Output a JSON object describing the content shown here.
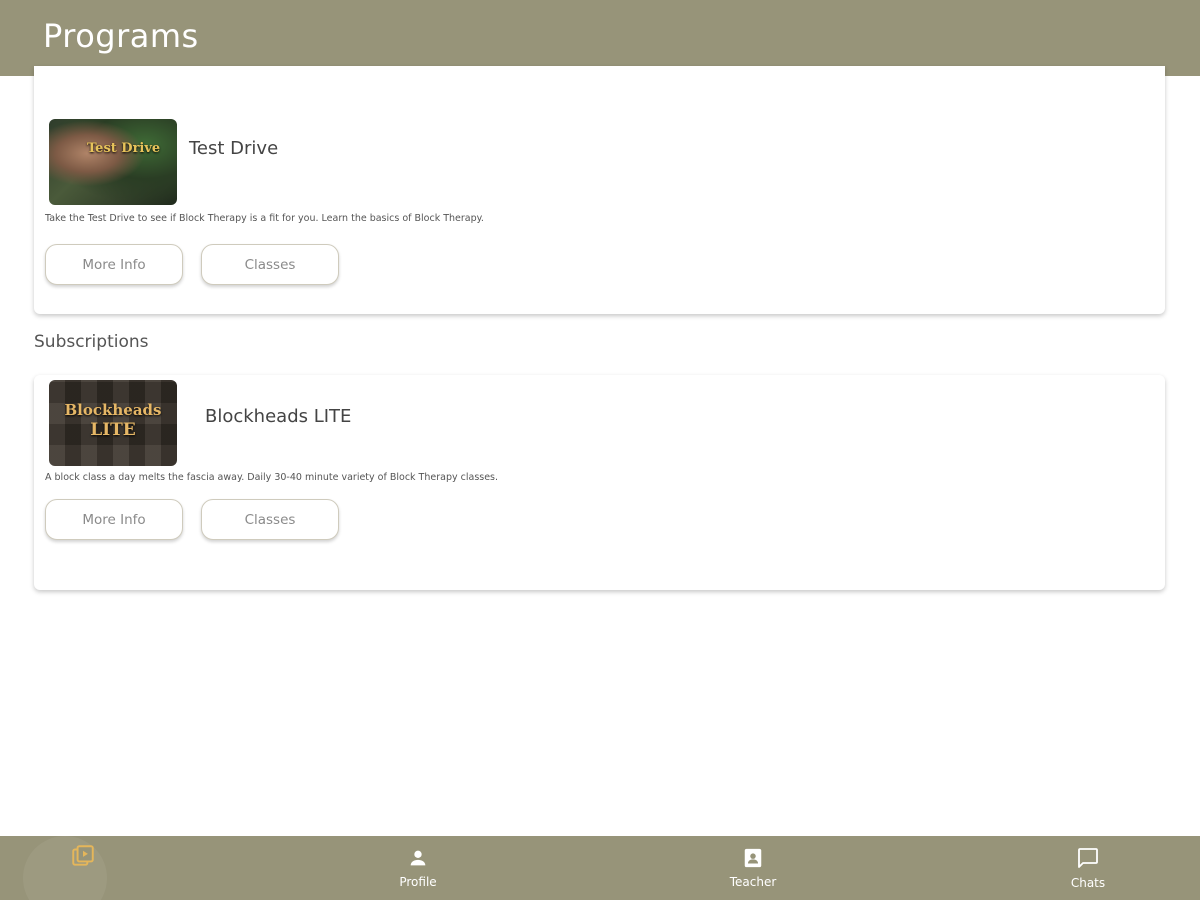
{
  "header": {
    "title": "Programs"
  },
  "programs": [
    {
      "name": "Test Drive",
      "thumbnail_text": "Test Drive",
      "description": "Take the Test Drive to see if Block Therapy is a fit for you.  Learn the basics of Block Therapy.",
      "more_info_label": "More Info",
      "classes_label": "Classes"
    }
  ],
  "subscriptions": {
    "section_title": "Subscriptions",
    "items": [
      {
        "name": "Blockheads LITE",
        "thumbnail_text_line1": "Blockheads",
        "thumbnail_text_line2": "LITE",
        "description": "A block class a day melts the fascia away.  Daily 30-40 minute variety of Block Therapy classes.",
        "more_info_label": "More Info",
        "classes_label": "Classes"
      }
    ]
  },
  "bottom_nav": {
    "items": [
      {
        "label": "",
        "icon": "video-library-icon",
        "active": true
      },
      {
        "label": "Profile",
        "icon": "person-icon",
        "active": false
      },
      {
        "label": "Teacher",
        "icon": "contact-card-icon",
        "active": false
      },
      {
        "label": "Chats",
        "icon": "chat-bubble-icon",
        "active": false
      }
    ]
  },
  "colors": {
    "header_bg": "#979479",
    "nav_bg": "#979479",
    "active_icon": "#e5b65a",
    "button_border": "#cfcbbd"
  }
}
